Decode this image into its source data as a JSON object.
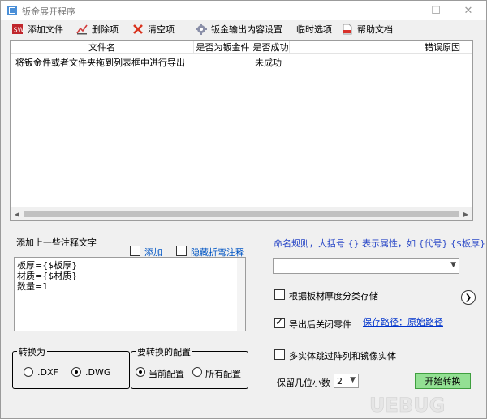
{
  "window": {
    "title": "钣金展开程序",
    "minimize": "—",
    "maximize": "☐",
    "close": "✕"
  },
  "toolbar": {
    "add_file": "添加文件",
    "delete_item": "删除项",
    "clear_items": "清空项",
    "output_settings": "钣金输出内容设置",
    "temp_options": "临时选项",
    "help_doc": "帮助文档"
  },
  "list": {
    "columns": [
      "文件名",
      "是否为钣金件",
      "是否成功",
      "错误原因"
    ],
    "rows": [
      {
        "filename": "将钣金件或者文件夹拖到列表框中进行导出",
        "is_sheetmetal": "",
        "success": "未成功",
        "error": ""
      }
    ]
  },
  "notes": {
    "label": "添加上一些注释文字",
    "add_label": "添加",
    "hide_bend_label": "隐藏折弯注释",
    "add_checked": false,
    "hide_bend_checked": false,
    "lines": [
      "板厚={$板厚}",
      "材质={$材质}",
      "数量=1"
    ]
  },
  "convert": {
    "title": "转换为",
    "options": [
      "DXF",
      "DWG"
    ],
    "selected": "DWG",
    "dxf_label": ".DXF",
    "dwg_label": ".DWG"
  },
  "config": {
    "title": "要转换的配置",
    "current_label": "当前配置",
    "all_label": "所有配置",
    "selected": "当前配置"
  },
  "right_panel": {
    "naming_rule": "命名规则，大括号 {} 表示属性，如 {代号} {$板厚}",
    "naming_value": "",
    "by_thickness_label": "根据板材厚度分类存储",
    "by_thickness_checked": false,
    "close_after_export_label": "导出后关闭零件",
    "close_after_export_checked": true,
    "save_path": "保存路径：原始路径",
    "multi_body_label": "多实体跳过阵列和镜像实体",
    "multi_body_checked": false,
    "decimals_label": "保留几位小数",
    "decimals_value": "2",
    "start_button": "开始转换"
  },
  "colors": {
    "start_button": "#93e093",
    "link": "#0033cc",
    "naming_rule": "#2b49c7"
  }
}
